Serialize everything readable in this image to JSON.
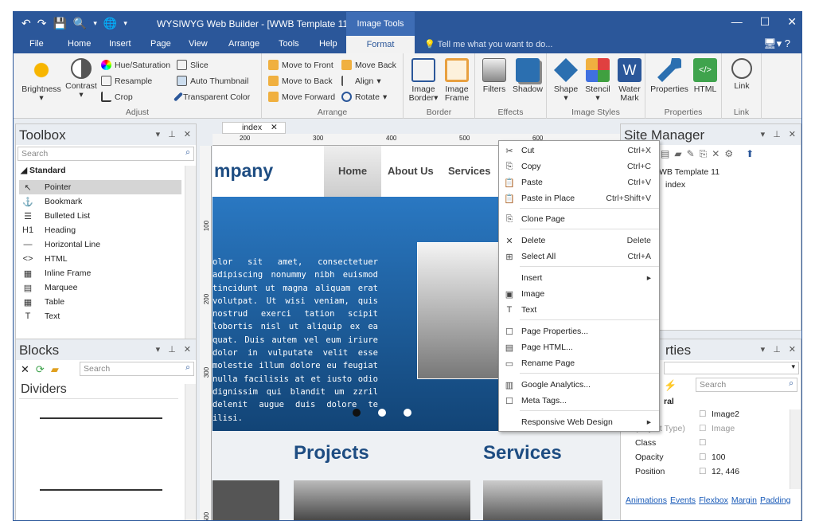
{
  "app": {
    "quick_icons": [
      "↶",
      "↷",
      "💾",
      "🔍",
      "▾",
      "🌐",
      "▾"
    ],
    "title": "WYSIWYG Web Builder - [WWB Template 11]",
    "context_tab": "Image Tools"
  },
  "menu": [
    "File",
    "Home",
    "Insert",
    "Page",
    "View",
    "Arrange",
    "Tools",
    "Help"
  ],
  "format_tab": "Format",
  "tell_me": "Tell me what you want to do...",
  "ribbon": {
    "adjust": {
      "label": "Adjust",
      "brightness": "Brightness",
      "contrast": "Contrast",
      "hue": "Hue/Saturation",
      "resample": "Resample",
      "crop": "Crop",
      "slice": "Slice",
      "auto_thumb": "Auto Thumbnail",
      "transparent": "Transparent Color"
    },
    "arrange": {
      "label": "Arrange",
      "front": "Move to Front",
      "back": "Move to Back",
      "forward": "Move Forward",
      "moveback": "Move Back",
      "align": "Align",
      "rotate": "Rotate"
    },
    "border": {
      "label": "Border",
      "image_border_1": "Image",
      "image_border_2": "Border",
      "image_frame_1": "Image",
      "image_frame_2": "Frame"
    },
    "effects": {
      "label": "Effects",
      "filters": "Filters",
      "shadow": "Shadow"
    },
    "styles": {
      "label": "Image Styles",
      "shape": "Shape",
      "stencil": "Stencil",
      "water_1": "Water",
      "water_2": "Mark"
    },
    "properties": {
      "label": "Properties",
      "props": "Properties",
      "html": "HTML"
    },
    "link": {
      "label": "Link",
      "link": "Link"
    }
  },
  "toolbox": {
    "title": "Toolbox",
    "search": "Search",
    "category": "Standard",
    "items": [
      {
        "icon": "↖",
        "label": "Pointer"
      },
      {
        "icon": "⚓",
        "label": "Bookmark"
      },
      {
        "icon": "☰",
        "label": "Bulleted List"
      },
      {
        "icon": "H1",
        "label": "Heading"
      },
      {
        "icon": "—",
        "label": "Horizontal Line"
      },
      {
        "icon": "<>",
        "label": "HTML"
      },
      {
        "icon": "▦",
        "label": "Inline Frame"
      },
      {
        "icon": "▤",
        "label": "Marquee"
      },
      {
        "icon": "▦",
        "label": "Table"
      },
      {
        "icon": "T",
        "label": "Text"
      }
    ]
  },
  "blocks": {
    "title": "Blocks",
    "search": "Search",
    "category": "Dividers"
  },
  "doc_tab": "index",
  "ruler": [
    "200",
    "300",
    "400",
    "500",
    "600"
  ],
  "vruler": [
    "100",
    "200",
    "300",
    "500"
  ],
  "site": {
    "company": "mpany",
    "nav": [
      "Home",
      "About Us",
      "Services"
    ],
    "hero_text": "olor sit amet, consectetuer adipiscing nonummy nibh euismod tincidunt ut magna aliquam erat volutpat. Ut wisi veniam, quis nostrud exerci tation scipit lobortis nisl ut aliquip ex ea quat. Duis autem vel eum iriure dolor in vulputate velit esse molestie illum dolore eu feugiat nulla facilisis at et iusto odio dignissim qui blandit um zzril delenit augue duis dolore te ilisi.",
    "projects": "Projects",
    "services": "Services"
  },
  "context_menu": [
    {
      "icon": "✂",
      "label": "Cut",
      "shortcut": "Ctrl+X"
    },
    {
      "icon": "⎘",
      "label": "Copy",
      "shortcut": "Ctrl+C"
    },
    {
      "icon": "📋",
      "label": "Paste",
      "shortcut": "Ctrl+V"
    },
    {
      "icon": "📋",
      "label": "Paste in Place",
      "shortcut": "Ctrl+Shift+V"
    },
    {
      "icon": "⎘",
      "label": "Clone Page",
      "shortcut": ""
    },
    {
      "icon": "✕",
      "label": "Delete",
      "shortcut": "Delete"
    },
    {
      "icon": "⊞",
      "label": "Select All",
      "shortcut": "Ctrl+A"
    },
    {
      "icon": "",
      "label": "Insert",
      "shortcut": "▸"
    },
    {
      "icon": "▣",
      "label": "Image",
      "shortcut": ""
    },
    {
      "icon": "T",
      "label": "Text",
      "shortcut": ""
    },
    {
      "icon": "☐",
      "label": "Page Properties...",
      "shortcut": ""
    },
    {
      "icon": "▤",
      "label": "Page HTML...",
      "shortcut": ""
    },
    {
      "icon": "▭",
      "label": "Rename Page",
      "shortcut": ""
    },
    {
      "icon": "▥",
      "label": "Google Analytics...",
      "shortcut": ""
    },
    {
      "icon": "☐",
      "label": "Meta Tags...",
      "shortcut": ""
    },
    {
      "icon": "",
      "label": "Responsive Web Design",
      "shortcut": "▸"
    }
  ],
  "site_manager": {
    "title": "Site Manager",
    "root": "WB Template 11",
    "page": "index"
  },
  "properties": {
    "title": "rties",
    "search": "Search",
    "group": "ral",
    "rows": [
      {
        "name": "",
        "value": "Image2"
      },
      {
        "name": "(Object Type)",
        "value": "Image"
      },
      {
        "name": "Class",
        "value": ""
      },
      {
        "name": "Opacity",
        "value": "100"
      },
      {
        "name": "Position",
        "value": "12, 446"
      }
    ],
    "links": [
      "Animations",
      "Events",
      "Flexbox",
      "Margin",
      "Padding"
    ]
  }
}
